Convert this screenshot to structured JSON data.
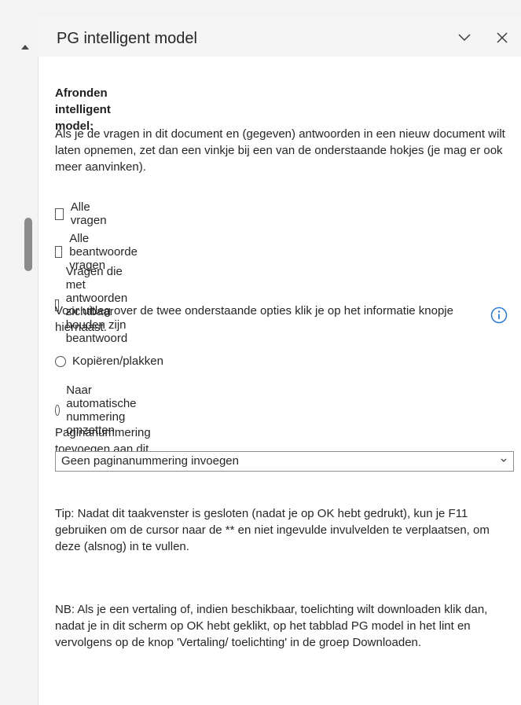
{
  "pane": {
    "title": "PG intelligent model"
  },
  "icons": {
    "collapse": "chevron-down-icon",
    "close": "close-icon",
    "info": "info-icon",
    "scroll_up": "scroll-up-arrow-icon"
  },
  "content": {
    "heading": "Afronden intelligent model:",
    "intro": "Als je de vragen in dit document en (gegeven) antwoorden in een nieuw document wilt laten opnemen, zet dan een vinkje bij een van de onderstaande hokjes (je mag er ook meer aanvinken).",
    "checkboxes": [
      {
        "label": "Alle vragen",
        "checked": false
      },
      {
        "label": "Alle beantwoorde vragen",
        "checked": false
      },
      {
        "label": "Vragen die met antwoorden zichtbaar houden zijn beantwoord",
        "checked": false
      }
    ],
    "options_info": "Voor uitleg over de twee onderstaande opties klik je op het informatie knopje hiernaast.",
    "radios": [
      {
        "label": "Kopiëren/plakken",
        "selected": false
      },
      {
        "label": "Naar automatische nummering omzetten",
        "selected": false
      }
    ],
    "page_numbering_label": "Paginanummering toevoegen aan dit document",
    "page_numbering_value": "Geen paginanummering invoegen",
    "tip": "Tip: Nadat dit taakvenster is gesloten (nadat je op OK hebt gedrukt), kun je F11 gebruiken om de cursor naar de ** en niet ingevulde invulvelden te verplaatsen, om deze (alsnog) in te vullen.",
    "nb": "NB: Als je een vertaling of, indien beschikbaar, toelichting wilt downloaden klik dan, nadat je in dit scherm op OK hebt geklikt, op het tabblad PG model in het lint en vervolgens op de knop 'Vertaling/ toelichting' in de groep Downloaden."
  },
  "colors": {
    "info_blue": "#2b7cd3",
    "pane_bg": "#ffffff",
    "header_bg": "#f5f5f5"
  }
}
